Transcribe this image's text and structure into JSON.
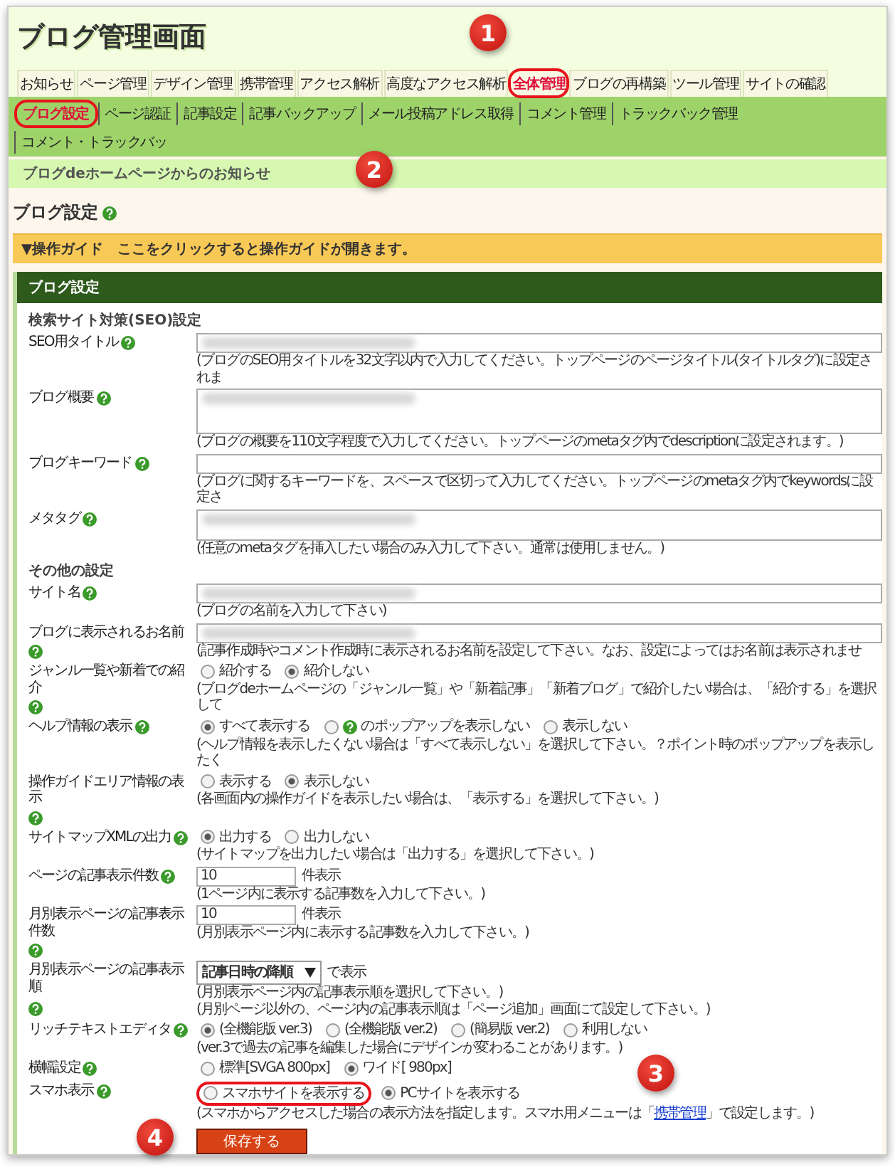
{
  "header": {
    "title": "ブログ管理画面"
  },
  "main_tabs": [
    {
      "label": "お知らせ",
      "selected": false,
      "circled": false
    },
    {
      "label": "ページ管理",
      "selected": false,
      "circled": false
    },
    {
      "label": "デザイン管理",
      "selected": false,
      "circled": false
    },
    {
      "label": "携帯管理",
      "selected": false,
      "circled": false
    },
    {
      "label": "アクセス解析",
      "selected": false,
      "circled": false
    },
    {
      "label": "高度なアクセス解析",
      "selected": false,
      "circled": false
    },
    {
      "label": "全体管理",
      "selected": true,
      "circled": true
    },
    {
      "label": "ブログの再構築",
      "selected": false,
      "circled": false
    },
    {
      "label": "ツール管理",
      "selected": false,
      "circled": false
    },
    {
      "label": "サイトの確認",
      "selected": false,
      "circled": false
    }
  ],
  "sub_tabs": [
    {
      "label": "ブログ設定",
      "selected": true,
      "circled": true
    },
    {
      "label": "ページ認証",
      "selected": false,
      "circled": false
    },
    {
      "label": "記事設定",
      "selected": false,
      "circled": false
    },
    {
      "label": "記事バックアップ",
      "selected": false,
      "circled": false
    },
    {
      "label": "メール投稿アドレス取得",
      "selected": false,
      "circled": false
    },
    {
      "label": "コメント管理",
      "selected": false,
      "circled": false
    },
    {
      "label": "トラックバック管理",
      "selected": false,
      "circled": false
    },
    {
      "label": "コメント・トラックバッ",
      "selected": false,
      "circled": false
    }
  ],
  "notice": "ブログdeホームページからのお知らせ",
  "page_title": "ブログ設定",
  "guide": "▼操作ガイド　ここをクリックすると操作ガイドが開きます。",
  "panel_title": "ブログ設定",
  "sections": [
    {
      "heading": "検索サイト対策(SEO)設定",
      "rows": [
        {
          "kind": "text",
          "label": "SEO用タイトル",
          "blurred": true,
          "hints": [
            {
              "text": "(ブログのSEO用タイトルを32文字以内で入力してください。トップページのページタイトル(タイトルタグ)に設定されま"
            }
          ]
        },
        {
          "kind": "textarea",
          "label": "ブログ概要",
          "blurred": true,
          "hints": [
            {
              "text": "(ブログの概要を110文字程度で入力してください。トップページのmetaタグ内でdescriptionに設定されます。)"
            }
          ]
        },
        {
          "kind": "text",
          "label": "ブログキーワード",
          "blurred": false,
          "hints": [
            {
              "text": "(ブログに関するキーワードを、スペースで区切って入力してください。トップページのmetaタグ内でkeywordsに設定さ"
            }
          ]
        },
        {
          "kind": "textarea_small",
          "label": "メタタグ",
          "blurred": true,
          "hints": [
            {
              "text": "(任意のmetaタグを挿入したい場合のみ入力して下さい。通常は使用しません。)"
            }
          ]
        }
      ]
    },
    {
      "heading": "その他の設定",
      "rows": [
        {
          "kind": "text",
          "label": "サイト名",
          "blurred": true,
          "hints": [
            {
              "text": "(ブログの名前を入力して下さい)"
            }
          ]
        },
        {
          "kind": "text",
          "label": "ブログに表示されるお名前",
          "blurred": true,
          "hints": [
            {
              "text": "(記事作成時やコメント作成時に表示されるお名前を設定して下さい。なお、設定によってはお名前は表示されませ"
            }
          ]
        },
        {
          "kind": "radio",
          "label": "ジャンル一覧や新着での紹介",
          "options": [
            {
              "label": "紹介する",
              "selected": false,
              "circled": false,
              "help": false
            },
            {
              "label": "紹介しない",
              "selected": true,
              "circled": false,
              "help": false
            }
          ],
          "hints": [
            {
              "text": "(ブログdeホームページの「ジャンル一覧」や「新着記事」「新着ブログ」で紹介したい場合は、「紹介する」を選択して"
            }
          ]
        },
        {
          "kind": "radio",
          "label": "ヘルプ情報の表示",
          "options": [
            {
              "label": "すべて表示する",
              "selected": true,
              "circled": false,
              "help": false
            },
            {
              "label": "のポップアップを表示しない",
              "selected": false,
              "circled": false,
              "help": true
            },
            {
              "label": "表示しない",
              "selected": false,
              "circled": false,
              "help": false
            }
          ],
          "hints": [
            {
              "text": "(ヘルプ情報を表示したくない場合は「すべて表示しない」を選択して下さい。？ポイント時のポップアップを表示したく"
            }
          ]
        },
        {
          "kind": "radio",
          "label": "操作ガイドエリア情報の表示",
          "options": [
            {
              "label": "表示する",
              "selected": false,
              "circled": false,
              "help": false
            },
            {
              "label": "表示しない",
              "selected": true,
              "circled": false,
              "help": false
            }
          ],
          "hints": [
            {
              "text": "(各画面内の操作ガイドを表示したい場合は、「表示する」を選択して下さい。)"
            }
          ]
        },
        {
          "kind": "radio",
          "label": "サイトマップXMLの出力",
          "options": [
            {
              "label": "出力する",
              "selected": true,
              "circled": false,
              "help": false
            },
            {
              "label": "出力しない",
              "selected": false,
              "circled": false,
              "help": false
            }
          ],
          "hints": [
            {
              "text": "(サイトマップを出力したい場合は「出力する」を選択して下さい。)"
            }
          ]
        },
        {
          "kind": "number",
          "label": "ページの記事表示件数",
          "value": "10",
          "suffix": "件表示",
          "hints": [
            {
              "text": "(1ページ内に表示する記事数を入力して下さい。)"
            }
          ]
        },
        {
          "kind": "number",
          "label": "月別表示ページの記事表示件数",
          "value": "10",
          "suffix": "件表示",
          "hints": [
            {
              "text": "(月別表示ページ内に表示する記事数を入力して下さい。)"
            }
          ]
        },
        {
          "kind": "select",
          "label": "月別表示ページの記事表示順",
          "value": "記事日時の降順",
          "suffix": "で表示",
          "hints": [
            {
              "text": "(月別表示ページ内の記事表示順を選択して下さい。)"
            },
            {
              "text": "(月別ページ以外の、ページ内の記事表示順は「ページ追加」画面にて設定して下さい。)"
            }
          ]
        },
        {
          "kind": "radio",
          "label": "リッチテキストエディタ",
          "options": [
            {
              "label": "(全機能版 ver.3)",
              "selected": true,
              "circled": false,
              "help": false
            },
            {
              "label": "(全機能版 ver.2)",
              "selected": false,
              "circled": false,
              "help": false
            },
            {
              "label": "(簡易版 ver.2)",
              "selected": false,
              "circled": false,
              "help": false
            },
            {
              "label": "利用しない",
              "selected": false,
              "circled": false,
              "help": false
            }
          ],
          "hints": [
            {
              "text": "(ver.3で過去の記事を編集した場合にデザインが変わることがあります。)"
            }
          ]
        },
        {
          "kind": "radio",
          "label": "横幅設定",
          "options": [
            {
              "label": "標準[SVGA 800px]",
              "selected": false,
              "circled": false,
              "help": false
            },
            {
              "label": "ワイド[ 980px]",
              "selected": true,
              "circled": false,
              "help": false
            }
          ],
          "hints": []
        },
        {
          "kind": "radio",
          "label": "スマホ表示",
          "options": [
            {
              "label": "スマホサイトを表示する",
              "selected": false,
              "circled": true,
              "help": false
            },
            {
              "label": "PCサイトを表示する",
              "selected": true,
              "circled": false,
              "help": false
            }
          ],
          "hints": [
            {
              "text": "(スマホからアクセスした場合の表示方法を指定します。スマホ用メニューは「",
              "link": "携帯管理",
              "after": "」で設定します。)"
            }
          ]
        }
      ]
    }
  ],
  "save_button": "保存する",
  "annotations": [
    {
      "number": "1"
    },
    {
      "number": "2"
    },
    {
      "number": "3"
    },
    {
      "number": "4"
    }
  ]
}
